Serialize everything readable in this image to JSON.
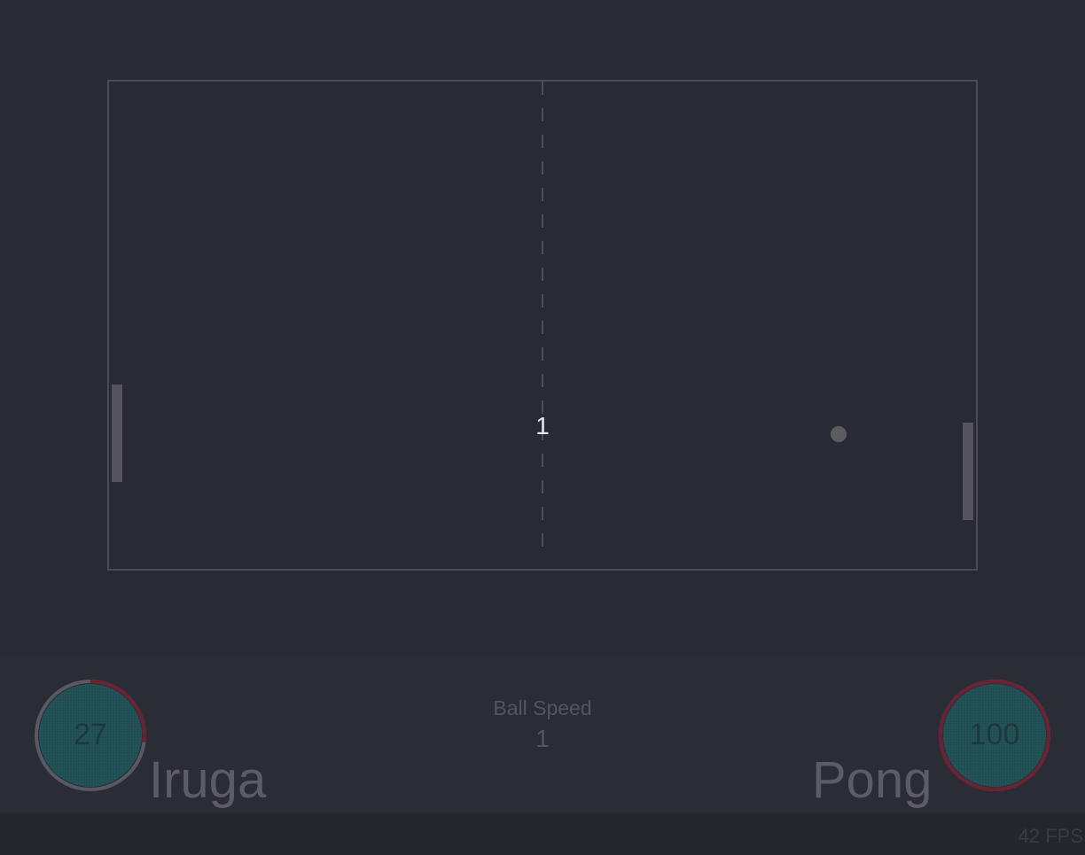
{
  "game": {
    "round_number": "1"
  },
  "players": {
    "left": {
      "name": "Iruga",
      "avatar_value": "27",
      "ring_progress": 0.27
    },
    "right": {
      "name": "Pong",
      "avatar_value": "100",
      "ring_progress": 1.0
    }
  },
  "hud": {
    "ball_speed_label": "Ball Speed",
    "ball_speed_value": "1"
  },
  "footer": {
    "fps": "42 FPS"
  },
  "colors": {
    "background": "#292a33",
    "field_border": "#4c4b55",
    "paddle": "#55545c",
    "ball": "#5d5c63",
    "ring_track": "#5a5963",
    "ring_progress": "#6b2233",
    "avatar_fill": "#1f4e52"
  }
}
